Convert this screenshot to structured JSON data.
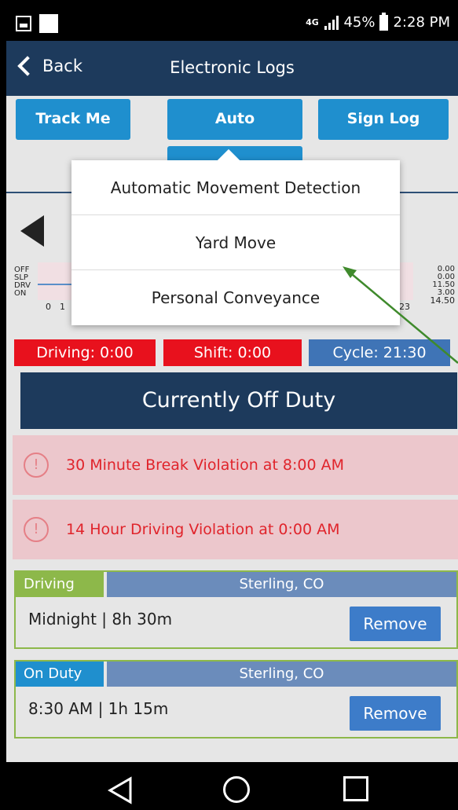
{
  "status_bar": {
    "network": "4G",
    "battery": "45%",
    "time": "2:28 PM"
  },
  "header": {
    "back_label": "Back",
    "title": "Electronic Logs"
  },
  "toolbar": {
    "track_me": "Track Me",
    "auto": "Auto",
    "sign_log": "Sign Log"
  },
  "dropdown": {
    "items": [
      "Automatic Movement Detection",
      "Yard Move",
      "Personal Conveyance"
    ]
  },
  "graph": {
    "rows": [
      "OFF",
      "SLP",
      "DRV",
      "ON"
    ],
    "start_ticks": [
      "0",
      "1"
    ],
    "end_tick": "23",
    "row_totals": [
      "0.00",
      "0.00",
      "11.50",
      "3.00"
    ],
    "grand_total": "14.50"
  },
  "counters": {
    "driving": "Driving: 0:00",
    "shift": "Shift: 0:00",
    "cycle": "Cycle: 21:30",
    "colors": {
      "driving": "#e8111d",
      "shift": "#e8111d",
      "cycle": "#3f74b6"
    }
  },
  "current_status": "Currently Off Duty",
  "violations": [
    {
      "icon": "alert-circle-icon",
      "text": "30 Minute Break Violation at 8:00 AM"
    },
    {
      "icon": "alert-circle-icon",
      "text": "14 Hour Driving Violation at 0:00 AM"
    }
  ],
  "log_entries": [
    {
      "type": "Driving",
      "type_color": "#8db84a",
      "location": "Sterling, CO",
      "time": "Midnight | 8h 30m",
      "action": "Remove"
    },
    {
      "type": "On Duty",
      "type_color": "#1f8fce",
      "location": "Sterling, CO",
      "time": "8:30 AM | 1h 15m",
      "action": "Remove"
    }
  ],
  "nav_bar": {
    "icons": [
      "back-triangle-icon",
      "home-circle-icon",
      "recent-apps-square-icon"
    ]
  },
  "annotation_color": "#3f8a2c"
}
